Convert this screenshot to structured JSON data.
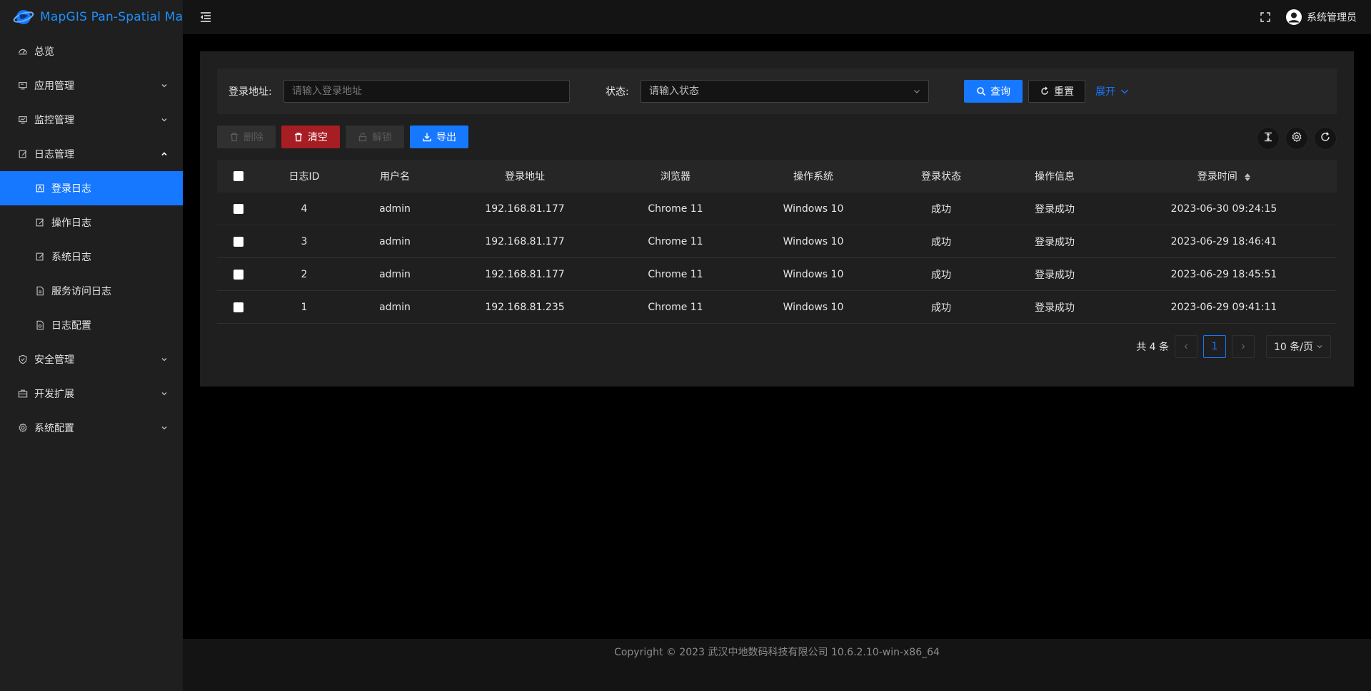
{
  "app": {
    "title": "MapGIS Pan-Spatial Map"
  },
  "sidebar": {
    "items": [
      {
        "label": "总览",
        "icon": "dashboard-icon"
      },
      {
        "label": "应用管理",
        "icon": "app-icon"
      },
      {
        "label": "监控管理",
        "icon": "monitor-icon"
      },
      {
        "label": "日志管理",
        "icon": "log-icon"
      },
      {
        "label": "安全管理",
        "icon": "shield-icon"
      },
      {
        "label": "开发扩展",
        "icon": "toolbox-icon"
      },
      {
        "label": "系统配置",
        "icon": "gear-icon"
      }
    ],
    "log_submenu": [
      {
        "label": "登录日志",
        "icon": "login-log-icon"
      },
      {
        "label": "操作日志",
        "icon": "edit-icon"
      },
      {
        "label": "系统日志",
        "icon": "edit-icon"
      },
      {
        "label": "服务访问日志",
        "icon": "file-icon"
      },
      {
        "label": "日志配置",
        "icon": "file-config-icon"
      }
    ]
  },
  "header": {
    "user_name": "系统管理员"
  },
  "filter": {
    "address_label": "登录地址:",
    "address_placeholder": "请输入登录地址",
    "status_label": "状态:",
    "status_placeholder": "请输入状态",
    "search_label": "查询",
    "reset_label": "重置",
    "expand_label": "展开"
  },
  "toolbar": {
    "delete_label": "删除",
    "clear_label": "清空",
    "unlock_label": "解锁",
    "export_label": "导出"
  },
  "table": {
    "columns": [
      "日志ID",
      "用户名",
      "登录地址",
      "浏览器",
      "操作系统",
      "登录状态",
      "操作信息",
      "登录时间"
    ],
    "rows": [
      [
        "4",
        "admin",
        "192.168.81.177",
        "Chrome 11",
        "Windows 10",
        "成功",
        "登录成功",
        "2023-06-30 09:24:15"
      ],
      [
        "3",
        "admin",
        "192.168.81.177",
        "Chrome 11",
        "Windows 10",
        "成功",
        "登录成功",
        "2023-06-29 18:46:41"
      ],
      [
        "2",
        "admin",
        "192.168.81.177",
        "Chrome 11",
        "Windows 10",
        "成功",
        "登录成功",
        "2023-06-29 18:45:51"
      ],
      [
        "1",
        "admin",
        "192.168.81.235",
        "Chrome 11",
        "Windows 10",
        "成功",
        "登录成功",
        "2023-06-29 09:41:11"
      ]
    ]
  },
  "pagination": {
    "total_label": "共 4 条",
    "current_page": "1",
    "page_size_label": "10 条/页"
  },
  "footer": {
    "copyright": "Copyright © 2023 武汉中地数码科技有限公司 10.6.2.10-win-x86_64"
  },
  "colors": {
    "primary": "#1677ff",
    "danger": "#a61d24",
    "sidebar_bg": "#1f1f1f",
    "content_bg": "#1f1f1f"
  }
}
